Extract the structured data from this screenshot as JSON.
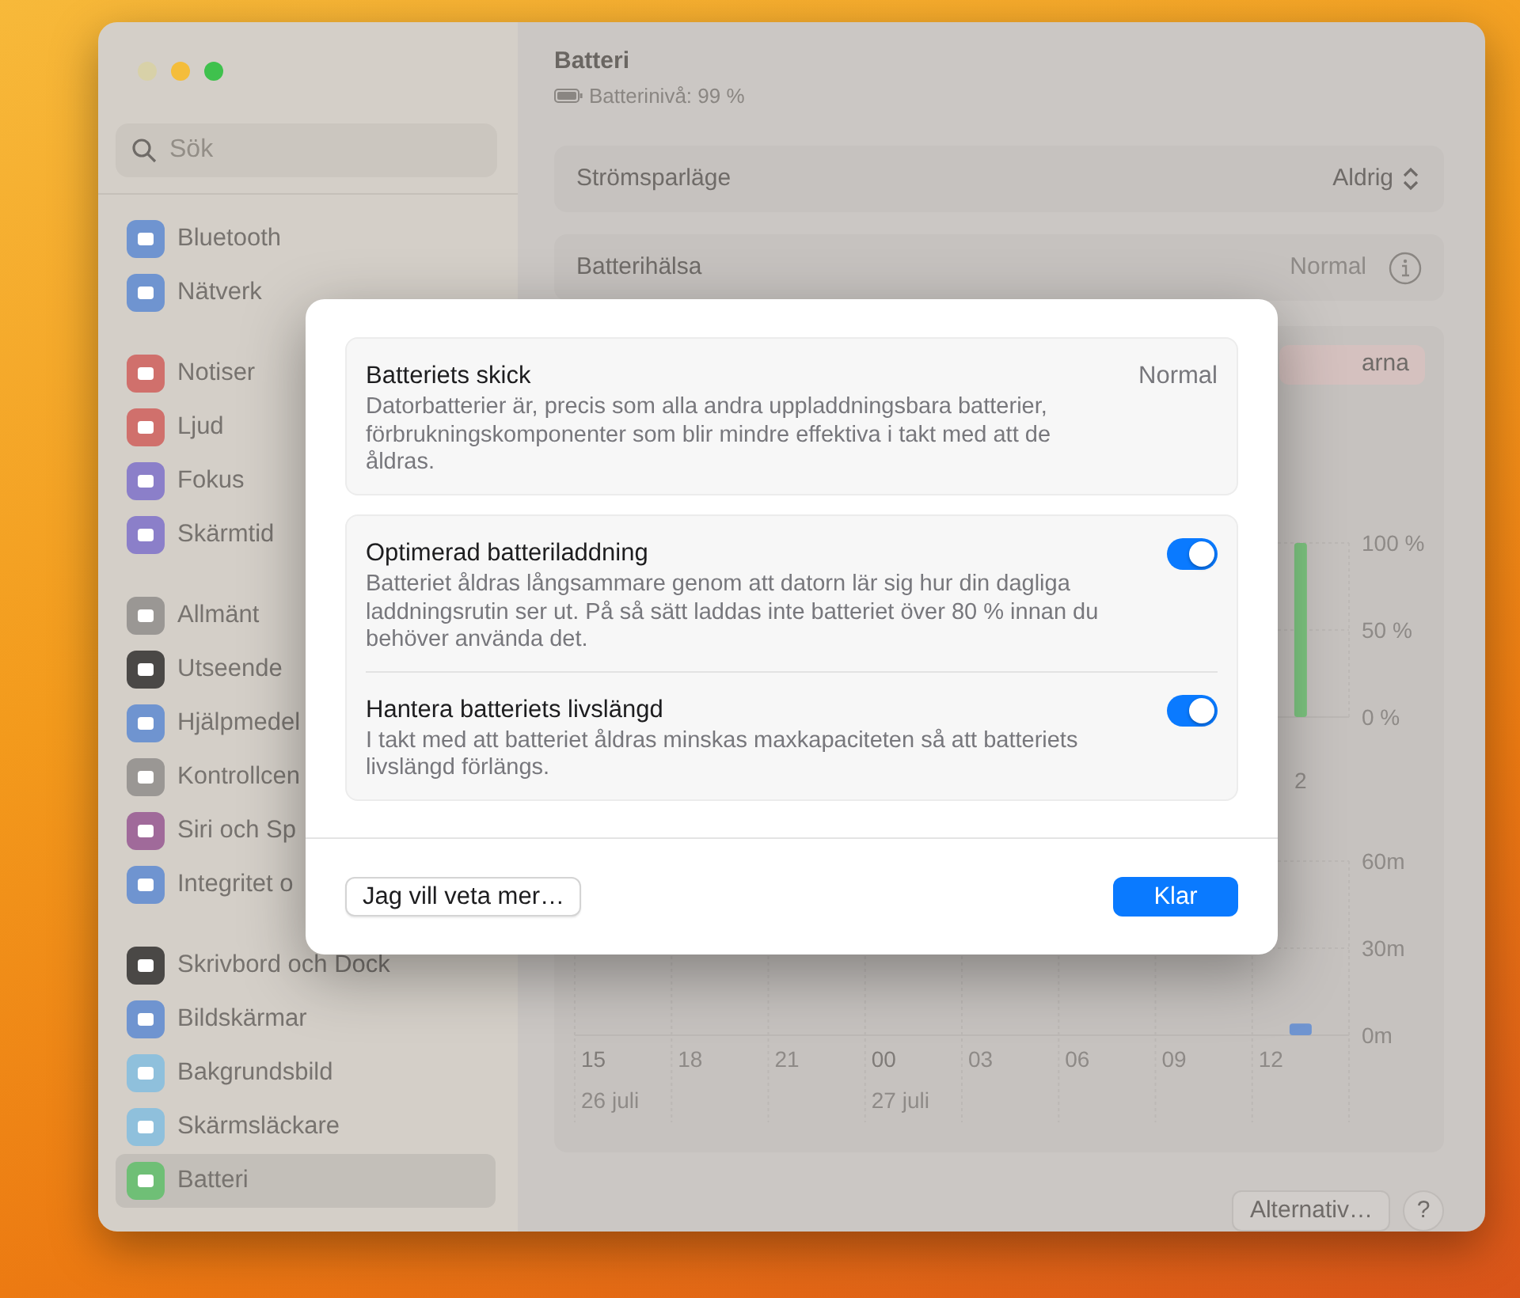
{
  "sidebar": {
    "search": {
      "placeholder": "Sök"
    },
    "groups": [
      [
        {
          "label": "Bluetooth",
          "color": "#6f94d0",
          "selected": false
        },
        {
          "label": "Nätverk",
          "color": "#6f94d0",
          "selected": false
        }
      ],
      [
        {
          "label": "Notiser",
          "color": "#d0706c",
          "selected": false
        },
        {
          "label": "Ljud",
          "color": "#d0706c",
          "selected": false
        },
        {
          "label": "Fokus",
          "color": "#8b7fc9",
          "selected": false
        },
        {
          "label": "Skärmtid",
          "color": "#8b7fc9",
          "selected": false
        }
      ],
      [
        {
          "label": "Allmänt",
          "color": "#9a9794",
          "selected": false
        },
        {
          "label": "Utseende",
          "color": "#4a4846",
          "selected": false
        },
        {
          "label": "Hjälpmedel",
          "color": "#6f94d0",
          "selected": false
        },
        {
          "label": "Kontrollcen",
          "color": "#9a9794",
          "selected": false
        },
        {
          "label": "Siri och Sp",
          "color": "#a06a9a",
          "selected": false
        },
        {
          "label": "Integritet o",
          "color": "#6f94d0",
          "selected": false
        }
      ],
      [
        {
          "label": "Skrivbord och Dock",
          "color": "#4a4846",
          "selected": false
        },
        {
          "label": "Bildskärmar",
          "color": "#6f94d0",
          "selected": false
        },
        {
          "label": "Bakgrundsbild",
          "color": "#8fc0dc",
          "selected": false
        },
        {
          "label": "Skärmsläckare",
          "color": "#8fc0dc",
          "selected": false
        },
        {
          "label": "Batteri",
          "color": "#6fbf76",
          "selected": true
        }
      ]
    ]
  },
  "header": {
    "title": "Batteri",
    "subtitle": "Batterinivå: 99 %"
  },
  "rows": [
    {
      "kind": "popup",
      "label": "Strömsparläge",
      "value": "Aldrig"
    },
    {
      "kind": "info",
      "label": "Batterihälsa",
      "value": "Normal"
    }
  ],
  "history_card": {
    "button": "arna",
    "level_chart": {
      "chart_data": {
        "type": "bar",
        "categories": [
          "2"
        ],
        "ylim": [
          0,
          100
        ],
        "yticks": [
          {
            "value": 0,
            "label": "0 %"
          },
          {
            "value": 50,
            "label": "50 %"
          },
          {
            "value": 100,
            "label": "100 %"
          }
        ],
        "series": [
          {
            "color": "#7cc47f",
            "values": [
              100
            ]
          }
        ]
      }
    },
    "usage_chart": {
      "chart_data": {
        "type": "bar",
        "categories": [
          "15",
          "18",
          "21",
          "00",
          "03",
          "06",
          "09",
          "12"
        ],
        "ylim": [
          0,
          60
        ],
        "yticks": [
          {
            "value": 0,
            "label": "0m"
          },
          {
            "value": 30,
            "label": "30m"
          },
          {
            "value": 60,
            "label": "60m"
          }
        ],
        "series": [
          {
            "color": "#6f94d0",
            "values": [
              null,
              null,
              null,
              null,
              null,
              null,
              null,
              4
            ]
          }
        ]
      },
      "day_starts": [
        true,
        false,
        false,
        true,
        false,
        false,
        false,
        false
      ],
      "date_labels": [
        "26 juli",
        "27 juli"
      ]
    }
  },
  "footer_buttons": [
    {
      "kind": "push",
      "label": "Alternativ…"
    },
    {
      "kind": "help",
      "label": "?"
    }
  ],
  "dialog": {
    "sections": [
      {
        "items": [
          {
            "kind": "status",
            "title": "Batteriets skick",
            "value": "Normal",
            "description": "Datorbatterier är, precis som alla andra uppladdningsbara batterier, förbrukningskomponenter som blir mindre effektiva i takt med att de åldras."
          }
        ]
      },
      {
        "items": [
          {
            "kind": "toggle",
            "title": "Optimerad batteriladdning",
            "on": true,
            "description": "Batteriet åldras långsammare genom att datorn lär sig hur din dagliga laddningsrutin ser ut. På så sätt laddas inte batteriet över 80 % innan du behöver använda det."
          },
          {
            "kind": "toggle",
            "title": "Hantera batteriets livslängd",
            "on": true,
            "description": "I takt med att batteriet åldras minskas maxkapaciteten så att batteriets livslängd förlängs."
          }
        ]
      }
    ],
    "buttons": [
      {
        "kind": "secondary",
        "label": "Jag vill veta mer…"
      },
      {
        "kind": "primary",
        "label": "Klar"
      }
    ]
  }
}
